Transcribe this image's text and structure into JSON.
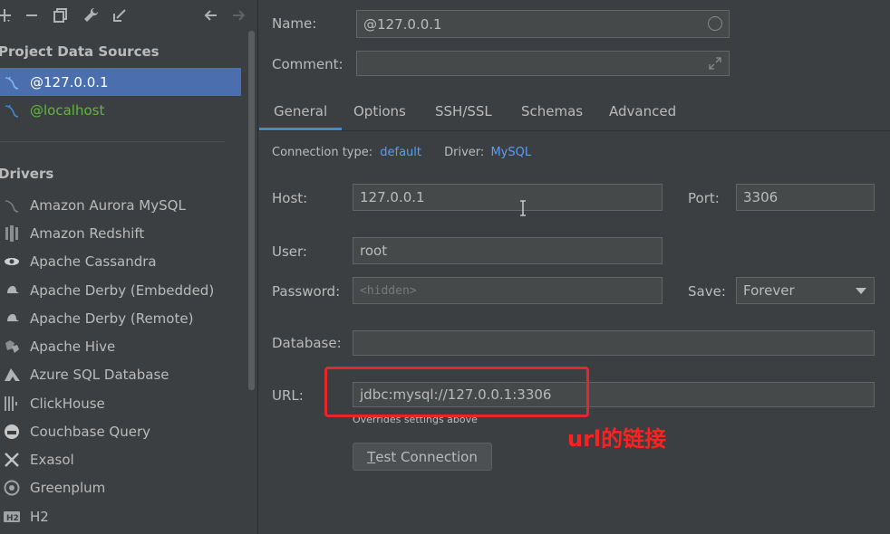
{
  "toolbar": {
    "icons": [
      "add-icon",
      "remove-icon",
      "duplicate-icon",
      "wrench-icon",
      "jump-to-icon",
      "back-icon",
      "forward-icon"
    ]
  },
  "sidebar": {
    "section_title": "Project Data Sources",
    "data_sources": [
      {
        "label": "@127.0.0.1",
        "selected": true,
        "icon": "mysql-dolphin-icon"
      },
      {
        "label": "@localhost",
        "selected": false,
        "icon": "mysql-dolphin-icon"
      }
    ],
    "drivers_title": "Drivers",
    "drivers": [
      {
        "label": "Amazon Aurora MySQL",
        "icon": "aurora-mysql-icon"
      },
      {
        "label": "Amazon Redshift",
        "icon": "redshift-icon"
      },
      {
        "label": "Apache Cassandra",
        "icon": "cassandra-icon"
      },
      {
        "label": "Apache Derby (Embedded)",
        "icon": "derby-icon"
      },
      {
        "label": "Apache Derby (Remote)",
        "icon": "derby-icon"
      },
      {
        "label": "Apache Hive",
        "icon": "hive-icon"
      },
      {
        "label": "Azure SQL Database",
        "icon": "azure-icon"
      },
      {
        "label": "ClickHouse",
        "icon": "clickhouse-icon"
      },
      {
        "label": "Couchbase Query",
        "icon": "couchbase-icon"
      },
      {
        "label": "Exasol",
        "icon": "exasol-icon"
      },
      {
        "label": "Greenplum",
        "icon": "greenplum-icon"
      },
      {
        "label": "H2",
        "icon": "h2-icon"
      }
    ]
  },
  "form": {
    "name_label": "Name:",
    "name_value": "@127.0.0.1",
    "comment_label": "Comment:",
    "comment_value": "",
    "tabs": [
      {
        "label": "General",
        "active": true
      },
      {
        "label": "Options",
        "active": false
      },
      {
        "label": "SSH/SSL",
        "active": false
      },
      {
        "label": "Schemas",
        "active": false
      },
      {
        "label": "Advanced",
        "active": false
      }
    ],
    "connection_type_label": "Connection type:",
    "connection_type_value": "default",
    "driver_label": "Driver:",
    "driver_value": "MySQL",
    "host_label": "Host:",
    "host_value": "127.0.0.1",
    "port_label": "Port:",
    "port_value": "3306",
    "user_label": "User:",
    "user_value": "root",
    "password_label": "Password:",
    "password_placeholder": "<hidden>",
    "save_label": "Save:",
    "save_value": "Forever",
    "database_label": "Database:",
    "database_value": "",
    "url_label": "URL:",
    "url_value": "jdbc:mysql://127.0.0.1:3306",
    "url_hint": "Overrides settings above",
    "test_button_label_first": "T",
    "test_button_label_rest": "est Connection"
  },
  "annotation": {
    "text": "url的链接",
    "color": "#e5262a"
  },
  "colors": {
    "background": "#3c3f41",
    "selection": "#4b6eaf",
    "link": "#589df6",
    "active_tab_underline": "#4a88c7",
    "localhost_green": "#62b543"
  }
}
